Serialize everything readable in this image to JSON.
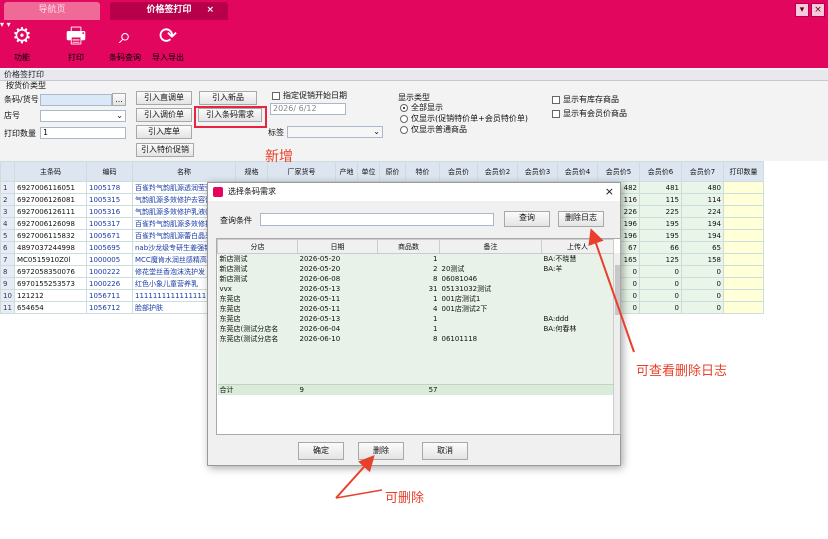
{
  "tabs": [
    {
      "label": "导航页"
    },
    {
      "label": "价格签打印",
      "close": "×"
    }
  ],
  "window_buttons": {
    "min": "▾",
    "close": "×"
  },
  "toolbar": [
    {
      "label": "功能",
      "icon": "gear-icon"
    },
    {
      "label": "打印",
      "icon": "printer-icon"
    },
    {
      "label": "条码查询",
      "icon": "barcode-search-icon"
    },
    {
      "label": "导入导出",
      "icon": "refresh-icon"
    }
  ],
  "page_title": "价格签打印",
  "filter": {
    "group_label": "按货价类型",
    "barcode_label": "条码/货号",
    "store_label": "店号",
    "print_qty_label": "打印数量",
    "print_qty_value": "1",
    "browse_label": "...",
    "buttons": {
      "import_adjust": "引入直调单",
      "import_new": "引入新品",
      "import_price_adjust": "引入调价单",
      "import_barcode": "引入条码需求",
      "import_instock": "引入库单",
      "import_special": "引入特价促销"
    },
    "promo_start_label": "指定促销开始日期",
    "promo_date": "2026/ 6/12",
    "tag_label": "标签",
    "display_type_label": "显示类型",
    "display_all": "全部显示",
    "display_only_promo": "仅显示(促销特价单+会员特价单)",
    "display_member": "仅显示普通商品",
    "show_stock": "显示有库存商品",
    "show_member_price": "显示有会员价商品"
  },
  "annotations": {
    "new": "新增",
    "view_log": "可查看删除日志",
    "deletable": "可删除"
  },
  "grid": {
    "headers": [
      "",
      "主条码",
      "编码",
      "名称",
      "规格",
      "厂家货号",
      "产地",
      "单位",
      "原价",
      "特价",
      "会员价",
      "会员价2",
      "会员价3",
      "会员价4",
      "会员价5",
      "会员价6",
      "会员价7",
      "打印数量"
    ],
    "rows": [
      {
        "no": "1",
        "barcode": "6927006116051",
        "code": "1005178",
        "name": "百雀羚气韵肌源透润莹莹",
        "p5": "483",
        "p6": "482",
        "p7": "481",
        "p8": "480"
      },
      {
        "no": "2",
        "barcode": "6927006126081",
        "code": "1005315",
        "name": "气韵肌源多效修护去容膏",
        "p5": "117",
        "p6": "116",
        "p7": "115",
        "p8": "114"
      },
      {
        "no": "3",
        "barcode": "6927006126111",
        "code": "1005316",
        "name": "气韵肌源多效修护乳液(新",
        "p5": "227",
        "p6": "226",
        "p7": "225",
        "p8": "224"
      },
      {
        "no": "4",
        "barcode": "6927006126098",
        "code": "1005317",
        "name": "百雀羚气韵肌源多效修护",
        "p5": "197",
        "p6": "196",
        "p7": "195",
        "p8": "194"
      },
      {
        "no": "5",
        "barcode": "6927006115832",
        "code": "1005671",
        "name": "百雀羚气韵肌源蕾白晶采",
        "p5": "197",
        "p6": "196",
        "p7": "195",
        "p8": "194"
      },
      {
        "no": "6",
        "barcode": "4897037244998",
        "code": "1005695",
        "name": "nab沙龙级专研生姜强韧防",
        "p5": "68",
        "p6": "67",
        "p7": "66",
        "p8": "65"
      },
      {
        "no": "7",
        "barcode": "MC0515910Z0l",
        "code": "1000005",
        "name": "MCC魔肯水润丝感精高霜",
        "p5": "170",
        "p6": "165",
        "p7": "125",
        "p8": "158"
      },
      {
        "no": "8",
        "barcode": "6972058350076",
        "code": "1000222",
        "name": "修花堂丝香泡沫洗护发",
        "p5": "0",
        "p6": "0",
        "p7": "0",
        "p8": "0"
      },
      {
        "no": "9",
        "barcode": "6970155253573",
        "code": "1000226",
        "name": "红色小象儿童营养乳",
        "p5": "0",
        "p6": "0",
        "p7": "0",
        "p8": "0"
      },
      {
        "no": "10",
        "barcode": "121212",
        "code": "1056711",
        "name": "1111111111111111111111",
        "p5": "0",
        "p6": "0",
        "p7": "0",
        "p8": "0"
      },
      {
        "no": "11",
        "barcode": "654654",
        "code": "1056712",
        "name": "脸部护肤",
        "p5": "0",
        "p6": "0",
        "p7": "0",
        "p8": "0"
      }
    ]
  },
  "dialog": {
    "title": "选择条码需求",
    "close": "×",
    "query_label": "查询条件",
    "query_value": "",
    "search_btn": "查询",
    "delete_log_btn": "删除日志",
    "headers": [
      "分店",
      "日期",
      "商品数",
      "备注",
      "上传人"
    ],
    "rows": [
      {
        "store": "新店测试",
        "date": "2026-05-20",
        "count": "1",
        "note": "",
        "user": "BA:不晓慧"
      },
      {
        "store": "新店测试",
        "date": "2026-05-20",
        "count": "2",
        "note": "20测试",
        "user": "BA:羊"
      },
      {
        "store": "新店测试",
        "date": "2026-06-08",
        "count": "8",
        "note": "06081046",
        "user": ""
      },
      {
        "store": "vvx",
        "date": "2026-05-13",
        "count": "31",
        "note": "05131032测试",
        "user": ""
      },
      {
        "store": "东莞店",
        "date": "2026-05-11",
        "count": "1",
        "note": "001店测试1",
        "user": ""
      },
      {
        "store": "东莞店",
        "date": "2026-05-11",
        "count": "4",
        "note": "001店测试2下",
        "user": ""
      },
      {
        "store": "东莞店",
        "date": "2026-05-13",
        "count": "1",
        "note": "",
        "user": "BA:ddd"
      },
      {
        "store": "东莞店(测试分店名",
        "date": "2026-06-04",
        "count": "1",
        "note": "",
        "user": "BA:何春林"
      },
      {
        "store": "东莞店(测试分店名",
        "date": "2026-06-10",
        "count": "8",
        "note": "06101118",
        "user": ""
      }
    ],
    "sum_label": "合计",
    "sum_count": "9",
    "sum_items": "57",
    "ok_btn": "确定",
    "delete_btn": "删除",
    "cancel_btn": "取消"
  }
}
